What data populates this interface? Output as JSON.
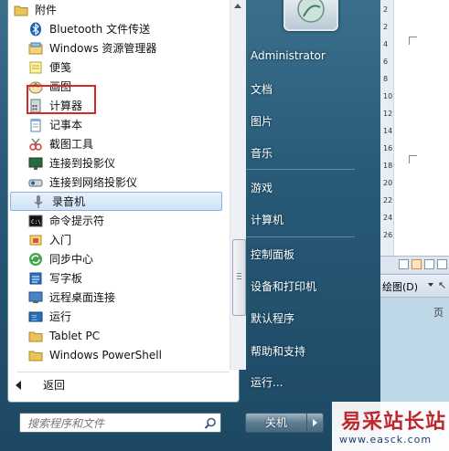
{
  "programs": {
    "items": [
      {
        "label": "附件",
        "icon": "folder-icon",
        "top": true
      },
      {
        "label": "Bluetooth 文件传送",
        "icon": "bluetooth-icon"
      },
      {
        "label": "Windows 资源管理器",
        "icon": "explorer-icon"
      },
      {
        "label": "便笺",
        "icon": "sticky-notes-icon"
      },
      {
        "label": "画图",
        "icon": "paint-icon"
      },
      {
        "label": "计算器",
        "icon": "calculator-icon"
      },
      {
        "label": "记事本",
        "icon": "notepad-icon"
      },
      {
        "label": "截图工具",
        "icon": "snipping-tool-icon"
      },
      {
        "label": "连接到投影仪",
        "icon": "projector-icon"
      },
      {
        "label": "连接到网络投影仪",
        "icon": "network-projector-icon"
      },
      {
        "label": "录音机",
        "icon": "microphone-icon",
        "selected": true
      },
      {
        "label": "命令提示符",
        "icon": "command-prompt-icon"
      },
      {
        "label": "入门",
        "icon": "getting-started-icon"
      },
      {
        "label": "同步中心",
        "icon": "sync-center-icon"
      },
      {
        "label": "写字板",
        "icon": "wordpad-icon"
      },
      {
        "label": "远程桌面连接",
        "icon": "remote-desktop-icon"
      },
      {
        "label": "运行",
        "icon": "run-icon"
      },
      {
        "label": "Tablet PC",
        "icon": "folder-icon"
      },
      {
        "label": "Windows PowerShell",
        "icon": "folder-icon"
      }
    ],
    "back_label": "返回"
  },
  "search": {
    "placeholder": "搜索程序和文件"
  },
  "right_menu": {
    "items": [
      "Administrator",
      "文档",
      "图片",
      "音乐",
      "游戏",
      "计算机",
      "控制面板",
      "设备和打印机",
      "默认程序",
      "帮助和支持",
      "运行..."
    ]
  },
  "shutdown": {
    "label": "关机"
  },
  "background_window": {
    "draw_label": "绘图(D)",
    "page_label": "页",
    "ruler_marks": [
      "2",
      "2",
      "4",
      "6",
      "8",
      "10",
      "12",
      "14",
      "16",
      "18",
      "20",
      "22",
      "24",
      "26"
    ]
  },
  "watermark": {
    "brand": "易采站长站",
    "url": "www.easck.com"
  },
  "colors": {
    "highlight_box": "#d12a2a",
    "selection_bg": "#cfe3f7",
    "watermark_red": "#c0272d"
  }
}
